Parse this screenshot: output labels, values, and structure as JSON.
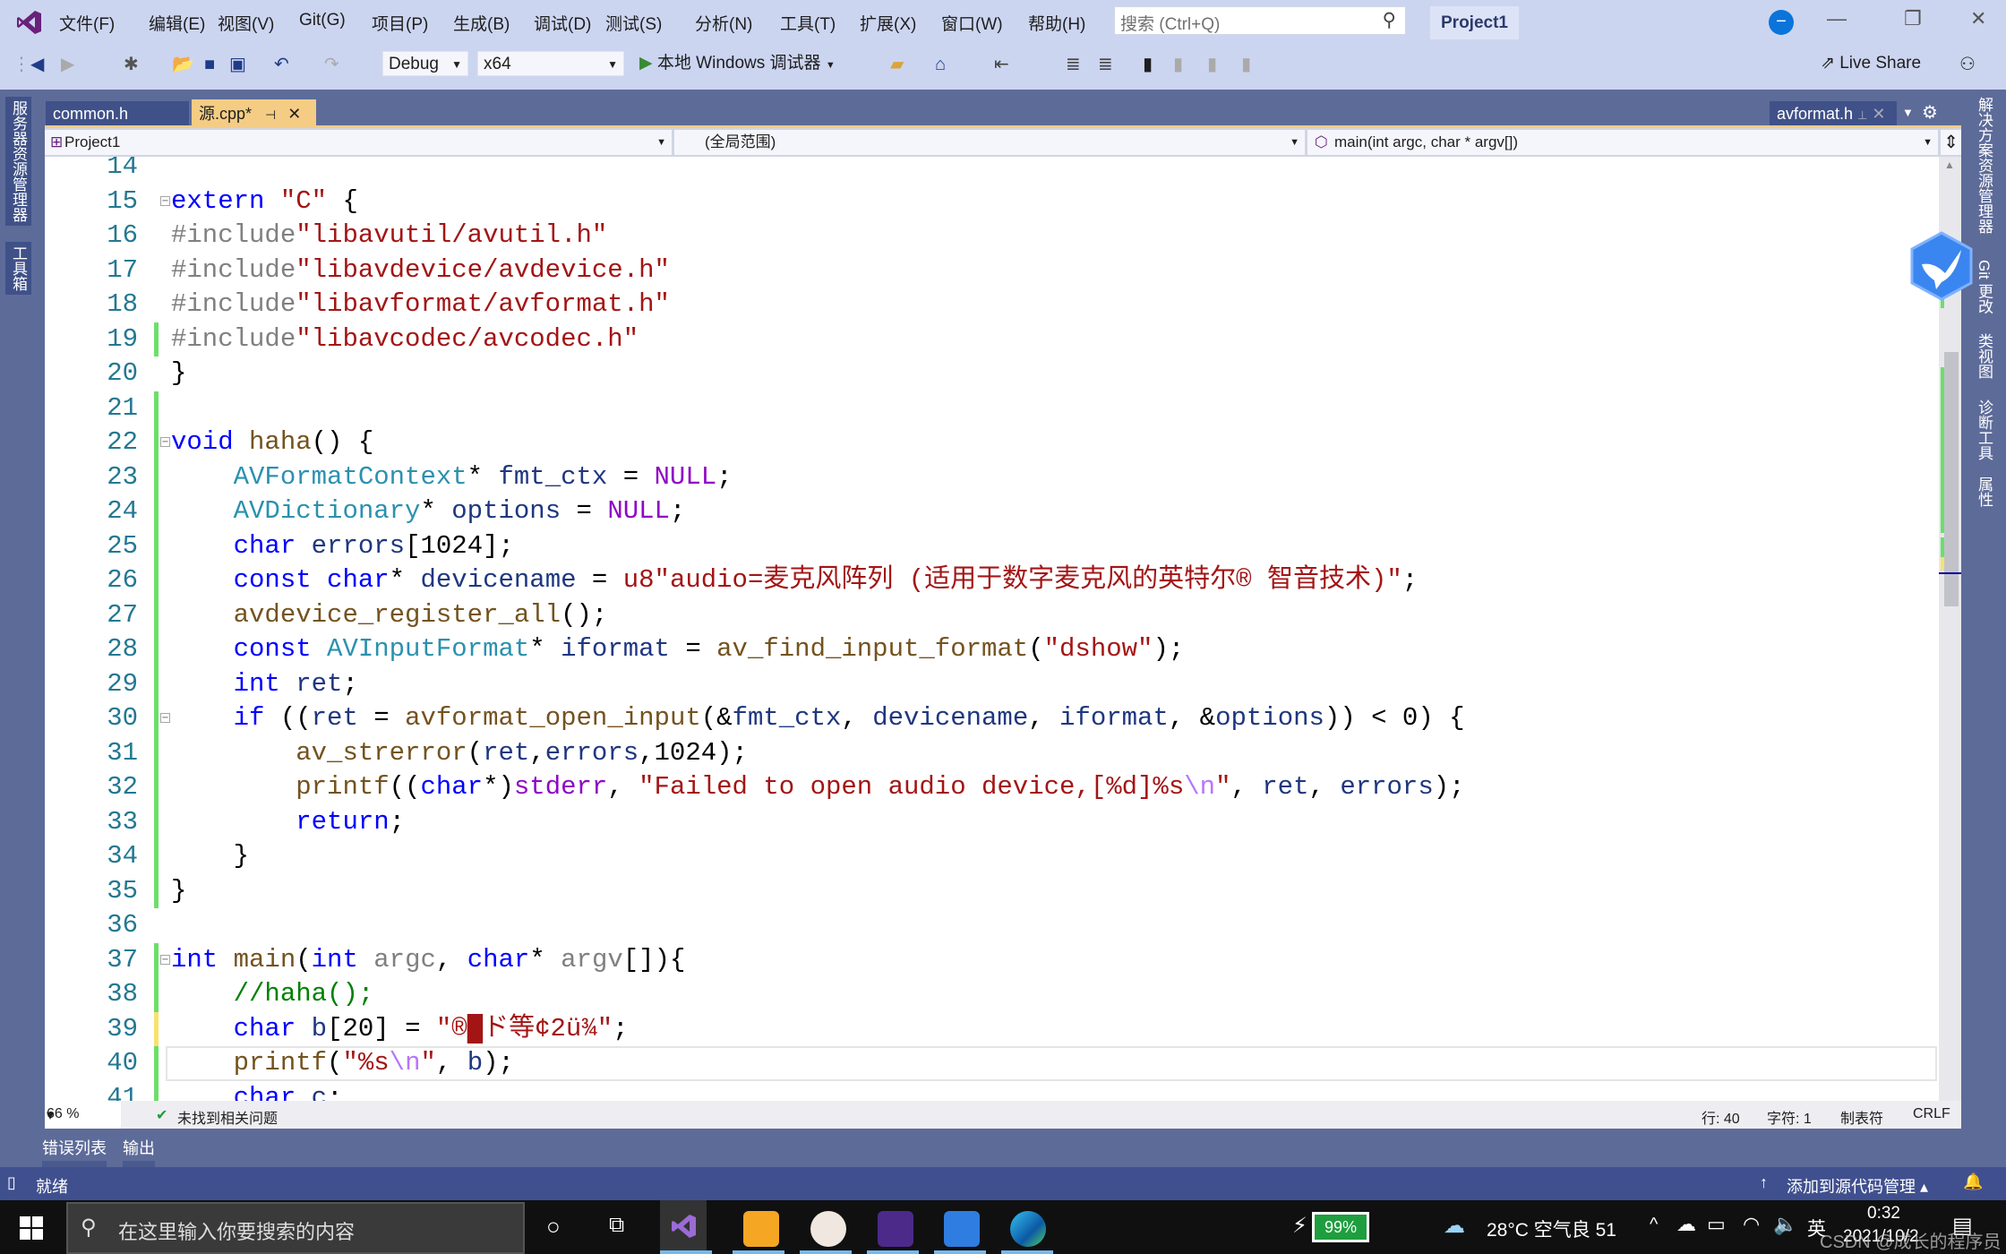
{
  "menubar": {
    "items": [
      "文件(F)",
      "编辑(E)",
      "视图(V)",
      "Git(G)",
      "项目(P)",
      "生成(B)",
      "调试(D)",
      "测试(S)",
      "分析(N)",
      "工具(T)",
      "扩展(X)",
      "窗口(W)",
      "帮助(H)"
    ],
    "search_placeholder": "搜索 (Ctrl+Q)",
    "project": "Project1"
  },
  "toolbar": {
    "config": "Debug",
    "platform": "x64",
    "run": "本地 Windows 调试器",
    "live_share": "Live Share"
  },
  "left_panel": [
    "服务器资源管理器",
    "工具箱"
  ],
  "right_panel": [
    "解决方案资源管理器",
    "Git 更改",
    "类视图",
    "诊断工具",
    "属性"
  ],
  "tabs": {
    "common": "common.h",
    "active": "源.cpp*",
    "right": "avformat.h"
  },
  "navbar": {
    "project": "Project1",
    "scope": "(全局范围)",
    "member": "main(int argc, char * argv[])"
  },
  "code": {
    "first_line": 14,
    "current_line": 40,
    "lines": [
      {
        "n": 14,
        "seg": []
      },
      {
        "n": 15,
        "fold": "-",
        "seg": [
          [
            "extern",
            "k"
          ],
          [
            " ",
            "n"
          ],
          [
            "\"C\"",
            "s"
          ],
          [
            " {",
            "n"
          ]
        ]
      },
      {
        "n": 16,
        "seg": [
          [
            "#include",
            "pp"
          ],
          [
            "\"libavutil/avutil.h\"",
            "s"
          ]
        ]
      },
      {
        "n": 17,
        "seg": [
          [
            "#include",
            "pp"
          ],
          [
            "\"libavdevice/avdevice.h\"",
            "s"
          ]
        ]
      },
      {
        "n": 18,
        "seg": [
          [
            "#include",
            "pp"
          ],
          [
            "\"libavformat/avformat.h\"",
            "s"
          ]
        ]
      },
      {
        "n": 19,
        "chg": "g",
        "seg": [
          [
            "#include",
            "pp"
          ],
          [
            "\"libavcodec/avcodec.h\"",
            "s"
          ]
        ]
      },
      {
        "n": 20,
        "seg": [
          [
            "}",
            "n"
          ]
        ]
      },
      {
        "n": 21,
        "chg": "g",
        "seg": []
      },
      {
        "n": 22,
        "chg": "g",
        "fold": "-",
        "seg": [
          [
            "void",
            "k"
          ],
          [
            " ",
            "n"
          ],
          [
            "haha",
            "f"
          ],
          [
            "() {",
            "n"
          ]
        ]
      },
      {
        "n": 23,
        "chg": "g",
        "seg": [
          [
            "    ",
            "n"
          ],
          [
            "AVFormatContext",
            "t"
          ],
          [
            "* ",
            "n"
          ],
          [
            "fmt_ctx",
            "v"
          ],
          [
            " = ",
            "n"
          ],
          [
            "NULL",
            "m"
          ],
          [
            ";",
            "n"
          ]
        ]
      },
      {
        "n": 24,
        "chg": "g",
        "seg": [
          [
            "    ",
            "n"
          ],
          [
            "AVDictionary",
            "t"
          ],
          [
            "* ",
            "n"
          ],
          [
            "options",
            "v"
          ],
          [
            " = ",
            "n"
          ],
          [
            "NULL",
            "m"
          ],
          [
            ";",
            "n"
          ]
        ]
      },
      {
        "n": 25,
        "chg": "g",
        "seg": [
          [
            "    ",
            "n"
          ],
          [
            "char",
            "k"
          ],
          [
            " ",
            "n"
          ],
          [
            "errors",
            "v"
          ],
          [
            "[1024];",
            "n"
          ]
        ]
      },
      {
        "n": 26,
        "chg": "g",
        "seg": [
          [
            "    ",
            "n"
          ],
          [
            "const",
            "k"
          ],
          [
            " ",
            "n"
          ],
          [
            "char",
            "k"
          ],
          [
            "* ",
            "n"
          ],
          [
            "devicename",
            "v"
          ],
          [
            " = ",
            "n"
          ],
          [
            "u8\"audio=麦克风阵列 (适用于数字麦克风的英特尔® 智音技术)\"",
            "s"
          ],
          [
            ";",
            "n"
          ]
        ]
      },
      {
        "n": 27,
        "chg": "g",
        "seg": [
          [
            "    ",
            "n"
          ],
          [
            "avdevice_register_all",
            "f"
          ],
          [
            "();",
            "n"
          ]
        ]
      },
      {
        "n": 28,
        "chg": "g",
        "seg": [
          [
            "    ",
            "n"
          ],
          [
            "const",
            "k"
          ],
          [
            " ",
            "n"
          ],
          [
            "AVInputFormat",
            "t"
          ],
          [
            "* ",
            "n"
          ],
          [
            "iformat",
            "v"
          ],
          [
            " = ",
            "n"
          ],
          [
            "av_find_input_format",
            "f"
          ],
          [
            "(",
            "n"
          ],
          [
            "\"dshow\"",
            "s"
          ],
          [
            ");",
            "n"
          ]
        ]
      },
      {
        "n": 29,
        "chg": "g",
        "seg": [
          [
            "    ",
            "n"
          ],
          [
            "int",
            "k"
          ],
          [
            " ",
            "n"
          ],
          [
            "ret",
            "v"
          ],
          [
            ";",
            "n"
          ]
        ]
      },
      {
        "n": 30,
        "chg": "g",
        "fold": "-",
        "seg": [
          [
            "    ",
            "n"
          ],
          [
            "if",
            "k"
          ],
          [
            " ((",
            "n"
          ],
          [
            "ret",
            "v"
          ],
          [
            " = ",
            "n"
          ],
          [
            "avformat_open_input",
            "f"
          ],
          [
            "(&",
            "n"
          ],
          [
            "fmt_ctx",
            "v"
          ],
          [
            ", ",
            "n"
          ],
          [
            "devicename",
            "v"
          ],
          [
            ", ",
            "n"
          ],
          [
            "iformat",
            "v"
          ],
          [
            ", &",
            "n"
          ],
          [
            "options",
            "v"
          ],
          [
            ")) < 0) {",
            "n"
          ]
        ]
      },
      {
        "n": 31,
        "chg": "g",
        "seg": [
          [
            "        ",
            "n"
          ],
          [
            "av_strerror",
            "f"
          ],
          [
            "(",
            "n"
          ],
          [
            "ret",
            "v"
          ],
          [
            ",",
            "n"
          ],
          [
            "errors",
            "v"
          ],
          [
            ",1024);",
            "n"
          ]
        ]
      },
      {
        "n": 32,
        "chg": "g",
        "seg": [
          [
            "        ",
            "n"
          ],
          [
            "printf",
            "f"
          ],
          [
            "((",
            "n"
          ],
          [
            "char",
            "k"
          ],
          [
            "*)",
            "n"
          ],
          [
            "stderr",
            "m"
          ],
          [
            ", ",
            "n"
          ],
          [
            "\"Failed to open audio device,[%d]%s",
            "s"
          ],
          [
            "\\n",
            "e"
          ],
          [
            "\"",
            "s"
          ],
          [
            ", ",
            "n"
          ],
          [
            "ret",
            "v"
          ],
          [
            ", ",
            "n"
          ],
          [
            "errors",
            "v"
          ],
          [
            ");",
            "n"
          ]
        ]
      },
      {
        "n": 33,
        "chg": "g",
        "seg": [
          [
            "        ",
            "n"
          ],
          [
            "return",
            "k"
          ],
          [
            ";",
            "n"
          ]
        ]
      },
      {
        "n": 34,
        "chg": "g",
        "seg": [
          [
            "    }",
            "n"
          ]
        ]
      },
      {
        "n": 35,
        "chg": "g",
        "seg": [
          [
            "}",
            "n"
          ]
        ]
      },
      {
        "n": 36,
        "seg": []
      },
      {
        "n": 37,
        "chg": "g",
        "fold": "-",
        "seg": [
          [
            "int",
            "k"
          ],
          [
            " ",
            "n"
          ],
          [
            "main",
            "f"
          ],
          [
            "(",
            "n"
          ],
          [
            "int",
            "k"
          ],
          [
            " ",
            "n"
          ],
          [
            "argc",
            "p"
          ],
          [
            ", ",
            "n"
          ],
          [
            "char",
            "k"
          ],
          [
            "* ",
            "n"
          ],
          [
            "argv",
            "p"
          ],
          [
            "[]){",
            "n"
          ]
        ]
      },
      {
        "n": 38,
        "chg": "g",
        "seg": [
          [
            "    ",
            "n"
          ],
          [
            "//haha();",
            "c"
          ]
        ]
      },
      {
        "n": 39,
        "chg": "y",
        "seg": [
          [
            "    ",
            "n"
          ],
          [
            "char",
            "k"
          ],
          [
            " ",
            "n"
          ],
          [
            "b",
            "v"
          ],
          [
            "[20] = ",
            "n"
          ],
          [
            "\"®",
            "s"
          ],
          [
            "█",
            "blk"
          ],
          [
            "ド等¢2ü¾\"",
            "s"
          ],
          [
            ";",
            "n"
          ]
        ]
      },
      {
        "n": 40,
        "chg": "g",
        "seg": [
          [
            "    ",
            "n"
          ],
          [
            "printf",
            "f"
          ],
          [
            "(",
            "n"
          ],
          [
            "\"%s",
            "s"
          ],
          [
            "\\n",
            "e"
          ],
          [
            "\"",
            "s"
          ],
          [
            ", ",
            "n"
          ],
          [
            "b",
            "v"
          ],
          [
            ");",
            "n"
          ]
        ]
      },
      {
        "n": 41,
        "chg": "g",
        "seg": [
          [
            "    ",
            "n"
          ],
          [
            "char",
            "k"
          ],
          [
            " ",
            "n"
          ],
          [
            "c",
            "v"
          ],
          [
            ";",
            "n"
          ]
        ]
      }
    ]
  },
  "status_strip": {
    "zoom": "66 %",
    "issues": "未找到相关问题",
    "line": "行: 40",
    "char": "字符: 1",
    "tabs": "制表符",
    "eol": "CRLF"
  },
  "bottom_tabs": [
    "错误列表",
    "输出"
  ],
  "statusbar": {
    "ready": "就绪",
    "source_control": "添加到源代码管理"
  },
  "taskbar": {
    "search": "在这里输入你要搜索的内容",
    "battery": "99%",
    "weather": "28°C 空气良 51",
    "ime": "英",
    "time": "0:32",
    "date": "2021/10/2",
    "watermark": "CSDN @成长的程序员"
  },
  "colors": {
    "accent": "#68217a",
    "tab_active": "#f5cc84",
    "status_bar": "#40508f",
    "change_saved": "#6bdf6b",
    "change_unsaved": "#f7e26b"
  }
}
